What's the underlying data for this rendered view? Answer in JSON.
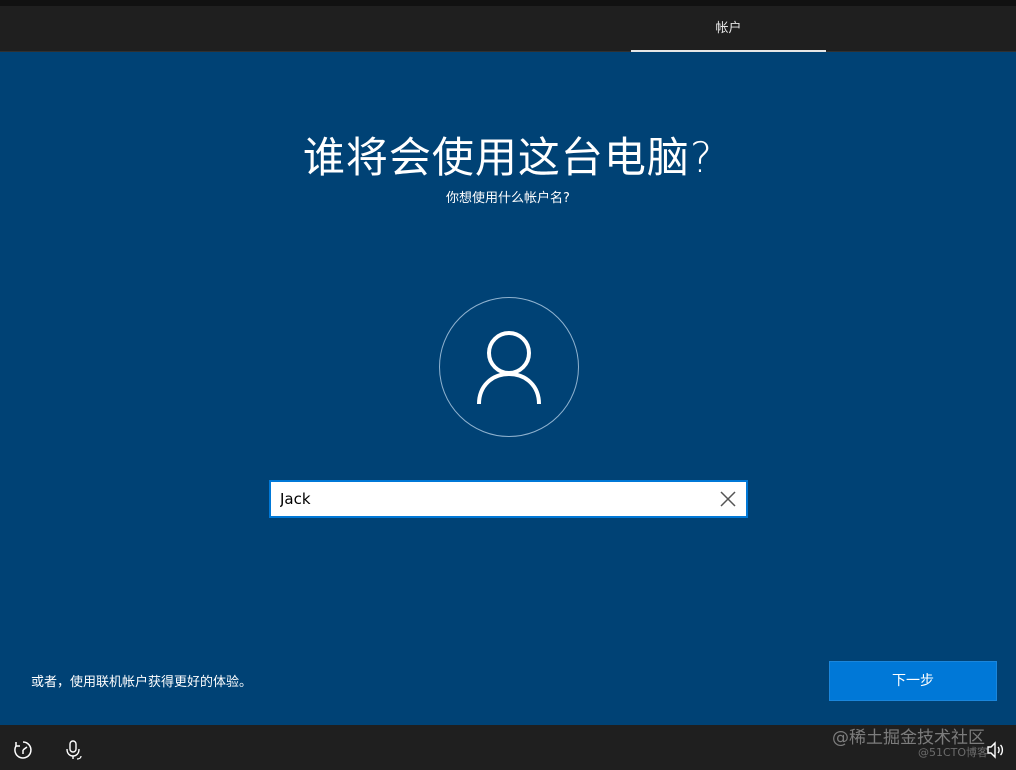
{
  "header": {
    "stage_tab_label": "帐户"
  },
  "main": {
    "title": "谁将会使用这台电脑?",
    "subtitle": "你想使用什么帐户名?",
    "name_input_value": "Jack"
  },
  "footer": {
    "online_account_text": "或者，使用联机帐户获得更好的体验。",
    "next_button_label": "下一步"
  },
  "watermark": {
    "main": "@稀土掘金技术社区",
    "sub": "@51CTO博客"
  },
  "icons": {
    "avatar": "person-icon",
    "clear": "close-icon",
    "ease_of_access": "ease-of-access-icon",
    "microphone": "microphone-icon",
    "volume": "volume-icon"
  },
  "colors": {
    "background": "#004275",
    "accent": "#0078d7",
    "bar": "#1f1f1f"
  }
}
